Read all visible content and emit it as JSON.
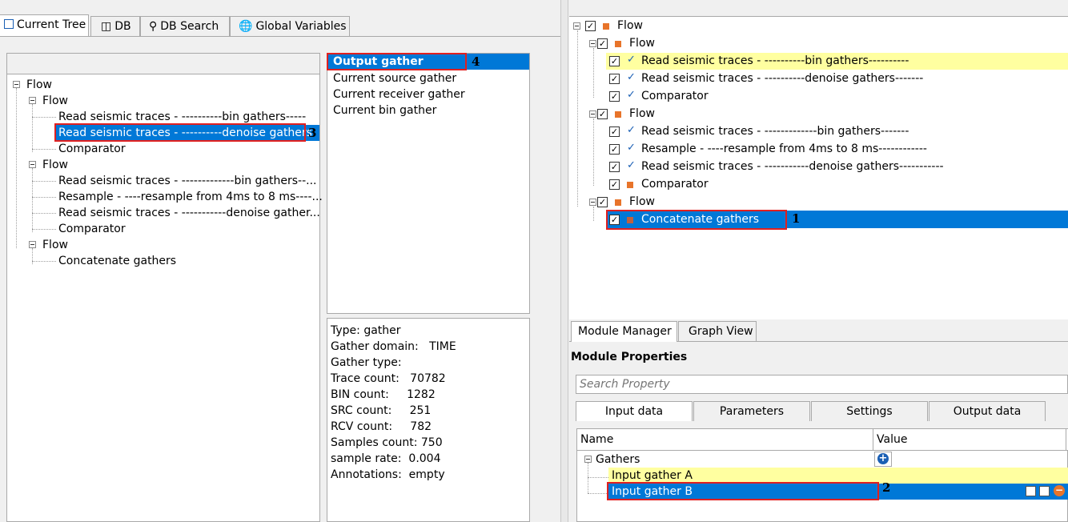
{
  "left_tabs": [
    {
      "label": "Current Tree",
      "icon": "tree-icon"
    },
    {
      "label": "DB",
      "icon": "database-icon"
    },
    {
      "label": "DB Search",
      "icon": "search-icon"
    },
    {
      "label": "Global Variables",
      "icon": "globe-icon"
    }
  ],
  "left_tree": {
    "root": "Flow",
    "flow1": "Flow",
    "f1_items": [
      "Read seismic traces - ----------bin gathers-----",
      "Read seismic traces - ----------denoise gathers",
      "Comparator"
    ],
    "flow2": "Flow",
    "f2_items": [
      "Read seismic traces - -------------bin gathers--...",
      "Resample - ----resample from 4ms to 8 ms----...",
      "Read seismic traces - -----------denoise gather...",
      "Comparator"
    ],
    "flow3": "Flow",
    "f3_items": [
      "Concatenate gathers"
    ]
  },
  "gather_list": [
    "Output gather",
    "Current source gather",
    "Current receiver gather",
    "Current bin gather"
  ],
  "info": [
    "Type: gather",
    "Gather domain:   TIME",
    "Gather type:",
    "Trace count:   70782",
    "BIN count:     1282",
    "SRC count:     251",
    "RCV count:     782",
    "Samples count: 750",
    "sample rate:  0.004",
    "Annotations:  empty"
  ],
  "right_tree": {
    "root": "Flow",
    "flow1": "Flow",
    "f1_items": [
      "Read seismic traces - ----------bin gathers----------",
      "Read seismic traces - ----------denoise gathers-------",
      "Comparator"
    ],
    "flow2": "Flow",
    "f2_items": [
      "Read seismic traces - -------------bin gathers-------",
      "Resample - ----resample from 4ms to 8 ms------------",
      "Read seismic traces - -----------denoise gathers-----------",
      "Comparator"
    ],
    "flow3": "Flow",
    "f3_items": [
      "Concatenate gathers"
    ]
  },
  "bottom_tabs": [
    "Module Manager",
    "Graph View"
  ],
  "module_properties": {
    "title": "Module Properties",
    "search_placeholder": "Search Property",
    "tabs": [
      "Input data",
      "Parameters",
      "Settings",
      "Output data"
    ],
    "col_name": "Name",
    "col_value": "Value",
    "group": "Gathers",
    "rows": [
      "Input gather A",
      "Input gather B"
    ]
  },
  "markers": [
    "1",
    "2",
    "3",
    "4"
  ],
  "colors": {
    "selection": "#0078d7",
    "highlight": "#ffffa0",
    "marker_box": "#e02020",
    "flow_square": "#e8742a"
  }
}
